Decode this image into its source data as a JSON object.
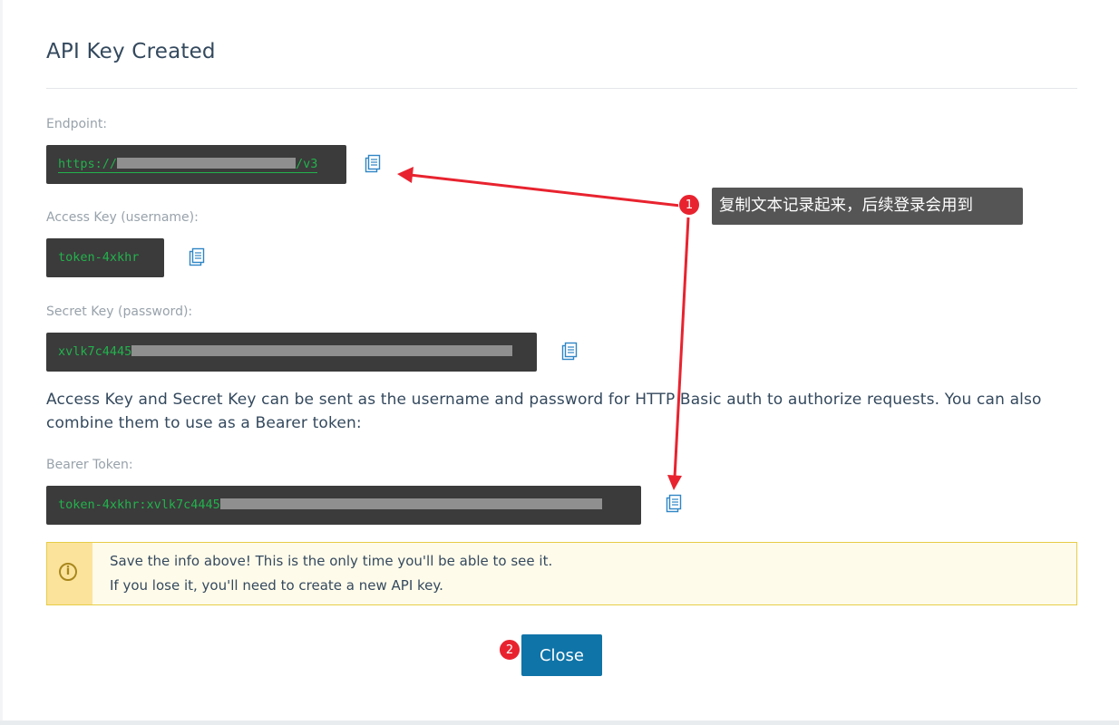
{
  "dialog": {
    "title": "API Key Created"
  },
  "fields": {
    "endpoint": {
      "label": "Endpoint:",
      "value_prefix": "https://",
      "value_suffix": "/v3"
    },
    "access_key": {
      "label": "Access Key (username):",
      "value": "token-4xkhr"
    },
    "secret_key": {
      "label": "Secret Key (password):",
      "value_prefix": "xvlk7c4445"
    },
    "bearer_token": {
      "label": "Bearer Token:",
      "value_prefix": "token-4xkhr:xvlk7c4445"
    }
  },
  "description": "Access Key and Secret Key can be sent as the username and password for HTTP Basic auth to authorize requests. You can also combine them to use as a Bearer token:",
  "warning": {
    "line1": "Save the info above! This is the only time you'll be able to see it.",
    "line2": "If you lose it, you'll need to create a new API key.",
    "icon": "info-circle-icon"
  },
  "actions": {
    "close_label": "Close"
  },
  "annotations": {
    "badge1": "1",
    "badge2": "2",
    "callout_text": "复制文本记录起来，后续登录会用到",
    "colors": {
      "badge": "#e8232f",
      "arrow": "#e8232f",
      "callout_bg": "#555555"
    }
  },
  "colors": {
    "code_bg": "#3b3b3b",
    "code_text": "#22b24c",
    "primary_button": "#0f74a8",
    "warning_bg": "#fffbea",
    "warning_border": "#e7cd47"
  }
}
